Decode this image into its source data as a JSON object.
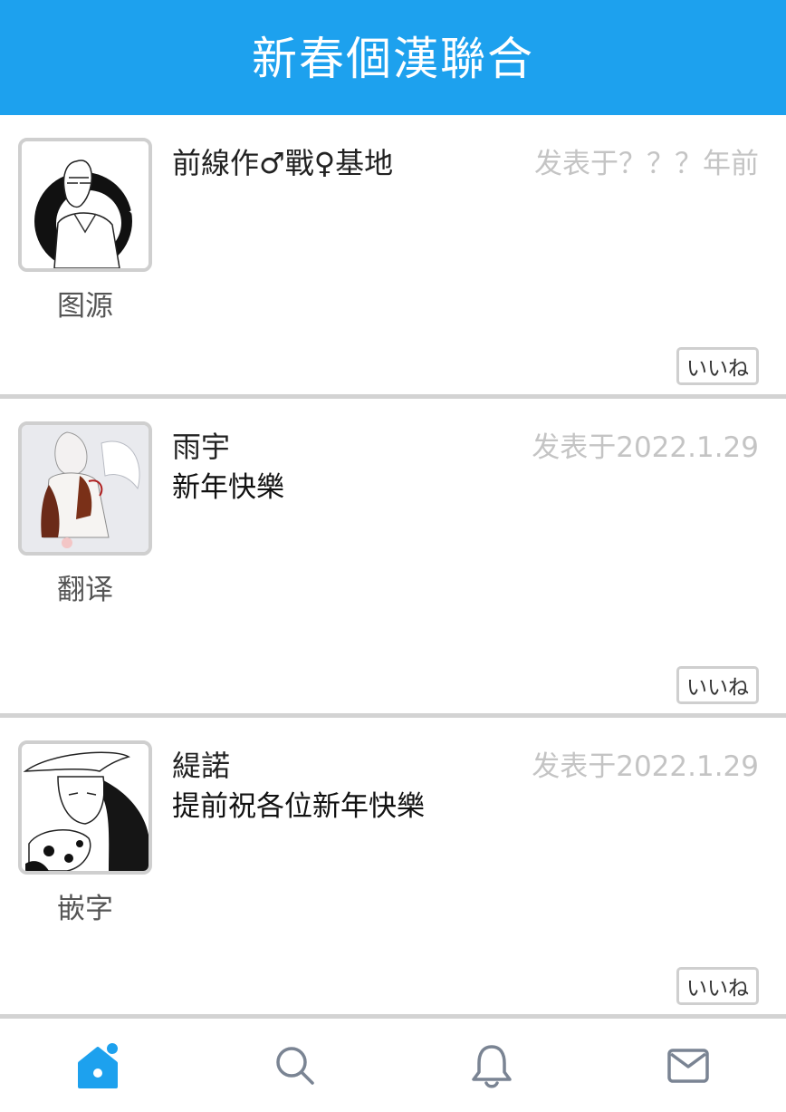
{
  "header": {
    "title": "新春個漢聯合"
  },
  "posts": [
    {
      "name": "前線作♂戰♀基地",
      "message": "",
      "time": "发表于？？？年前",
      "role": "图源",
      "like_label": "いいね",
      "avatar_icon": "manga-sketch-avatar"
    },
    {
      "name": "雨宇",
      "message": "新年快樂",
      "time": "发表于2022.1.29",
      "role": "翻译",
      "like_label": "いいね",
      "avatar_icon": "angel-girl-avatar"
    },
    {
      "name": "緹諾",
      "message": "提前祝各位新年快樂",
      "time": "发表于2022.1.29",
      "role": "嵌字",
      "like_label": "いいね",
      "avatar_icon": "cowboy-hat-man-avatar"
    }
  ],
  "tabbar": {
    "tabs": [
      {
        "icon": "home-icon",
        "active": true
      },
      {
        "icon": "search-icon",
        "active": false
      },
      {
        "icon": "bell-icon",
        "active": false
      },
      {
        "icon": "mail-icon",
        "active": false
      }
    ]
  },
  "colors": {
    "accent": "#1da1ee",
    "divider": "#d3d3d3",
    "muted": "#c4c4c4",
    "icon_inactive": "#7a8493"
  }
}
